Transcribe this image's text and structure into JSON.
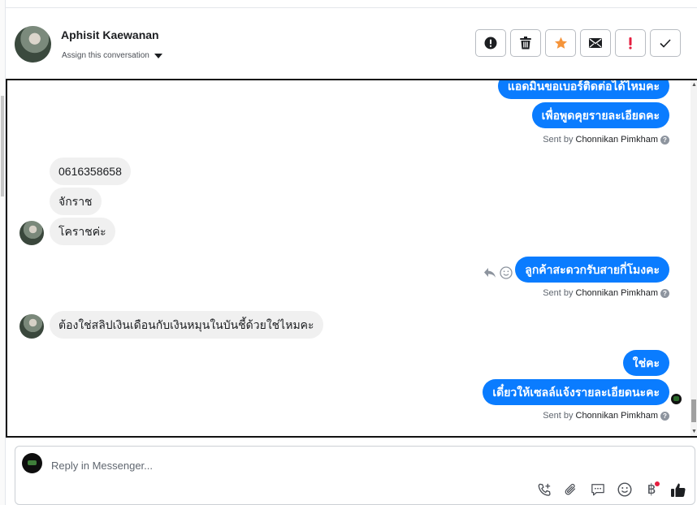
{
  "header": {
    "contact_name": "Aphisit Kaewanan",
    "assign_label": "Assign this conversation",
    "toolbar": [
      {
        "icon": "alert-circle-icon"
      },
      {
        "icon": "trash-icon"
      },
      {
        "icon": "star-icon",
        "color": "#f5943a"
      },
      {
        "icon": "envelope-icon"
      },
      {
        "icon": "exclamation-icon",
        "color": "#e41e3f"
      },
      {
        "icon": "check-icon"
      }
    ]
  },
  "conversation": {
    "outgoing_1": "แอดมินขอเบอร์ติดต่อได้ไหมคะ",
    "outgoing_2": "เพื่อพูดคุยรายละเอียดคะ",
    "sent_by_prefix": "Sent by",
    "agent_name": "Chonnikan Pimkham",
    "incoming_1": "0616358658",
    "incoming_2": "จักราช",
    "incoming_3": "โคราชค่ะ",
    "outgoing_3": "ลูกค้าสะดวกรับสายกี่โมงคะ",
    "incoming_4": "ต้องใช่สลิปเงินเดือนกับเงินหมุนในบันชี้ด้วยใช่ไหมคะ",
    "outgoing_4": "ใช่คะ",
    "outgoing_5": "เดี๋ยวให้เซลล์แจ้งรายละเอียดนะคะ"
  },
  "composer": {
    "placeholder": "Reply in Messenger...",
    "icons": [
      "phone-add-icon",
      "paperclip-icon",
      "saved-reply-icon",
      "emoji-icon",
      "baht-icon",
      "thumbs-up-icon"
    ],
    "baht_symbol": "฿"
  },
  "colors": {
    "outgoing_bubble": "#0a7cff",
    "incoming_bubble": "#f0f0f0",
    "notification_dot": "#e41e3f"
  }
}
